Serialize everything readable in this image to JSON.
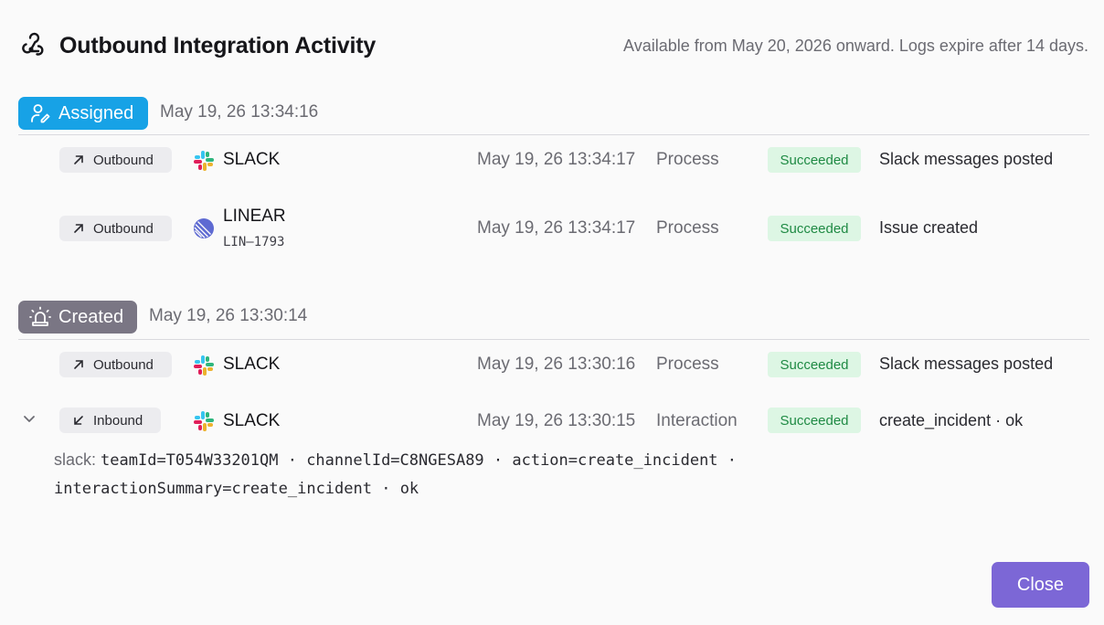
{
  "header": {
    "title": "Outbound Integration Activity",
    "note": "Available from May 20, 2026 onward. Logs expire after 14 days.",
    "icon": "webhook-icon"
  },
  "groups": [
    {
      "label": "Assigned",
      "time": "May 19, 26 13:34:16",
      "color": "#17a2e6",
      "icon": "user-pen-icon",
      "rows": [
        {
          "direction": "Outbound",
          "service": "SLACK",
          "service_icon": "slack-icon",
          "sub": "",
          "timestamp": "May 19, 26 13:34:17",
          "kind": "Process",
          "status": "Succeeded",
          "message": "Slack messages posted"
        },
        {
          "direction": "Outbound",
          "service": "LINEAR",
          "service_icon": "linear-icon",
          "sub": "LIN–1793",
          "timestamp": "May 19, 26 13:34:17",
          "kind": "Process",
          "status": "Succeeded",
          "message": "Issue created"
        }
      ]
    },
    {
      "label": "Created",
      "time": "May 19, 26 13:30:14",
      "color": "#7a7684",
      "icon": "siren-icon",
      "rows": [
        {
          "direction": "Outbound",
          "service": "SLACK",
          "service_icon": "slack-icon",
          "sub": "",
          "timestamp": "May 19, 26 13:30:16",
          "kind": "Process",
          "status": "Succeeded",
          "message": "Slack messages posted"
        },
        {
          "direction": "Inbound",
          "service": "SLACK",
          "service_icon": "slack-icon",
          "sub": "",
          "timestamp": "May 19, 26 13:30:15",
          "kind": "Interaction",
          "status": "Succeeded",
          "message": "create_incident · ok",
          "expanded": true
        }
      ]
    }
  ],
  "detail": {
    "label": "slack:",
    "line1": "teamId=T054W33201QM · channelId=C8NGESA89 · action=create_incident ·",
    "line2": "interactionSummary=create_incident · ok"
  },
  "footer": {
    "close_label": "Close",
    "accent": "#7c67d6"
  },
  "colors": {
    "status_bg": "#ddf6e4",
    "status_text": "#1f8a44"
  }
}
